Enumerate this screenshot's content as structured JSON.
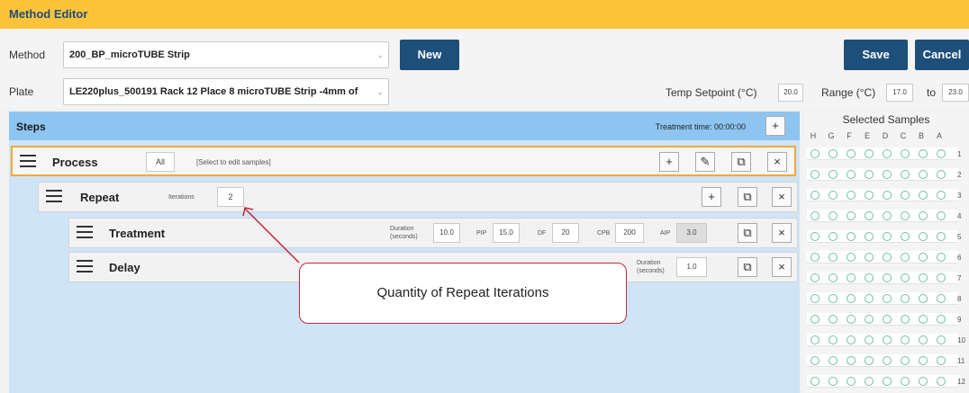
{
  "app": {
    "title": "Method Editor"
  },
  "method": {
    "label": "Method",
    "value": "200_BP_microTUBE Strip"
  },
  "plate": {
    "label": "Plate",
    "value": "LE220plus_500191 Rack 12 Place 8 microTUBE Strip -4mm of"
  },
  "buttons": {
    "new": "New",
    "save": "Save",
    "cancel": "Cancel"
  },
  "temp": {
    "label": "Temp Setpoint (°C)",
    "setpoint": "20.0",
    "range_label": "Range (°C)",
    "range_min": "17.0",
    "to_label": "to",
    "range_max": "23.0"
  },
  "steps": {
    "title": "Steps",
    "treatment_time": "Treatment time: 00:00:00",
    "process": {
      "label": "Process",
      "samples_filter": "All",
      "samples_hint": "[Select to edit samples]"
    },
    "repeat": {
      "label": "Repeat",
      "iterations_label": "Iterations",
      "iterations": "2"
    },
    "treatment": {
      "label": "Treatment",
      "duration_label": "Duration (seconds)",
      "duration": "10.0",
      "pip_label": "PIP",
      "pip": "15.0",
      "df_label": "DF",
      "df": "20",
      "cpb_label": "CPB",
      "cpb": "200",
      "aip_label": "AIP",
      "aip": "3.0"
    },
    "delay": {
      "label": "Delay",
      "duration_label": "Duration (seconds)",
      "duration": "1.0"
    }
  },
  "samples": {
    "title": "Selected Samples",
    "columns": [
      "H",
      "G",
      "F",
      "E",
      "D",
      "C",
      "B",
      "A"
    ],
    "rows": [
      "1",
      "2",
      "3",
      "4",
      "5",
      "6",
      "7",
      "8",
      "9",
      "10",
      "11",
      "12"
    ]
  },
  "annotation": {
    "text": "Quantity of Repeat Iterations",
    "color": "#c0283a"
  },
  "icons": {
    "add": "plus-box-icon",
    "edit": "pencil-icon",
    "copy": "copy-icon",
    "delete": "close-box-icon",
    "menu": "hamburger-icon"
  },
  "colors": {
    "title_bar": "#fdc33b",
    "title_text": "#1d4e7b",
    "button": "#1e4e7a",
    "steps_header": "#8ec5f0",
    "steps_bg": "#cfe4f7",
    "selected_border": "#f0a93a",
    "well": "#6fc0aa"
  }
}
